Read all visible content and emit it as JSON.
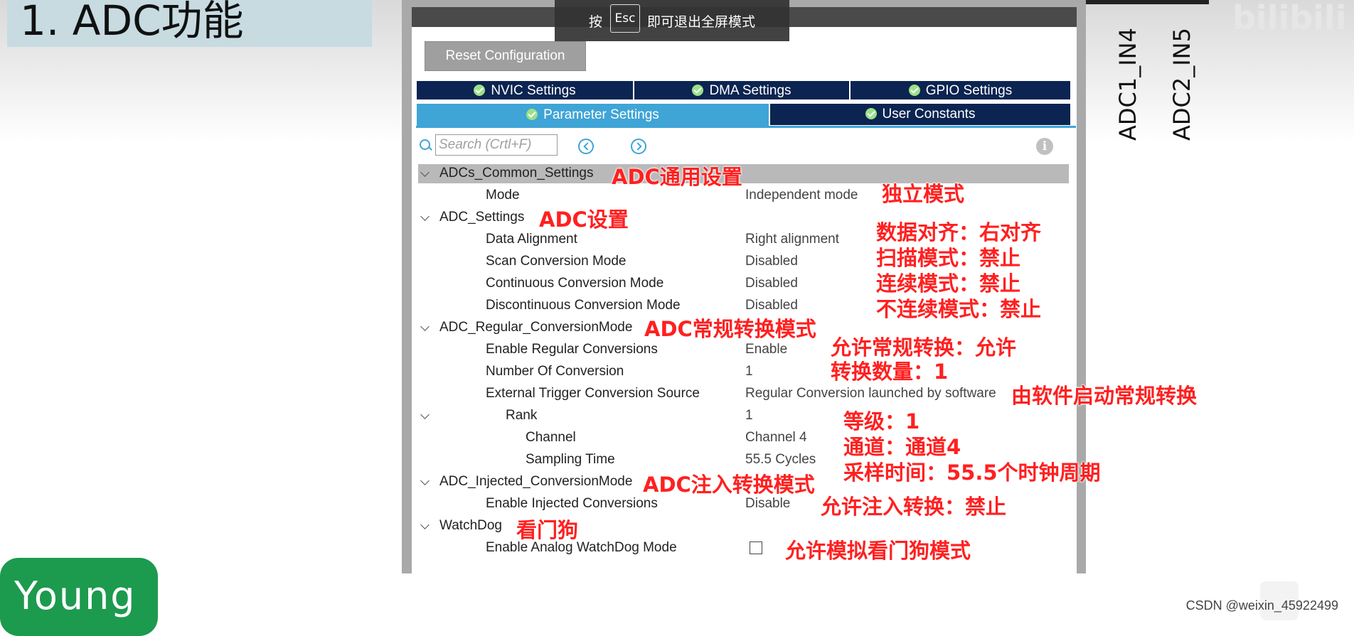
{
  "slide": {
    "title": "1. ADC功能",
    "badge": "Young",
    "pin_labels": [
      "ADC1_IN4",
      "ADC2_IN5"
    ],
    "logo": "bilibili",
    "watermark": "CSDN @weixin_45922499"
  },
  "fullscreen_tip": {
    "prefix": "按",
    "key": "Esc",
    "suffix": "即可退出全屏模式"
  },
  "toolbar": {
    "reset_label": "Reset Configuration"
  },
  "tabs": [
    {
      "label": "NVIC Settings",
      "active": false
    },
    {
      "label": "DMA Settings",
      "active": false
    },
    {
      "label": "GPIO Settings",
      "active": false
    },
    {
      "label": "Parameter Settings",
      "active": true
    },
    {
      "label": "User Constants",
      "active": false
    }
  ],
  "search": {
    "placeholder": "Search (Crtl+F)"
  },
  "tree": [
    {
      "label": "ADCs_Common_Settings",
      "value": "",
      "group": true
    },
    {
      "label": "Mode",
      "value": "Independent mode",
      "group": false
    },
    {
      "label": "ADC_Settings",
      "value": "",
      "group": true
    },
    {
      "label": "Data Alignment",
      "value": "Right alignment",
      "group": false
    },
    {
      "label": "Scan Conversion Mode",
      "value": "Disabled",
      "group": false
    },
    {
      "label": "Continuous Conversion Mode",
      "value": "Disabled",
      "group": false
    },
    {
      "label": "Discontinuous Conversion Mode",
      "value": "Disabled",
      "group": false
    },
    {
      "label": "ADC_Regular_ConversionMode",
      "value": "",
      "group": true
    },
    {
      "label": "Enable Regular Conversions",
      "value": "Enable",
      "group": false
    },
    {
      "label": "Number Of Conversion",
      "value": "1",
      "group": false
    },
    {
      "label": "External Trigger Conversion Source",
      "value": "Regular Conversion launched by software",
      "group": false
    },
    {
      "label": "Rank",
      "value": "1",
      "group": true
    },
    {
      "label": "Channel",
      "value": "Channel 4",
      "group": false
    },
    {
      "label": "Sampling Time",
      "value": "55.5 Cycles",
      "group": false
    },
    {
      "label": "ADC_Injected_ConversionMode",
      "value": "",
      "group": true
    },
    {
      "label": "Enable Injected Conversions",
      "value": "Disable",
      "group": false
    },
    {
      "label": "WatchDog",
      "value": "",
      "group": true
    },
    {
      "label": "Enable Analog WatchDog Mode",
      "value": "",
      "group": false,
      "checked": false
    }
  ],
  "annotations": [
    "ADC通用设置",
    "独立模式",
    "ADC设置",
    "数据对齐：右对齐",
    "扫描模式：禁止",
    "连续模式：禁止",
    "不连续模式：禁止",
    "ADC常规转换模式",
    "允许常规转换：允许",
    "转换数量：1",
    "由软件启动常规转换",
    "等级：1",
    "通道：通道4",
    "采样时间：55.5个时钟周期",
    "ADC注入转换模式",
    "允许注入转换：禁止",
    "看门狗",
    "允许模拟看门狗模式"
  ],
  "colors": {
    "tab_bg": "#0b2451",
    "tab_active": "#3fa4d6",
    "annotation": "#ff2020",
    "badge_bg": "#1c9a4e"
  }
}
